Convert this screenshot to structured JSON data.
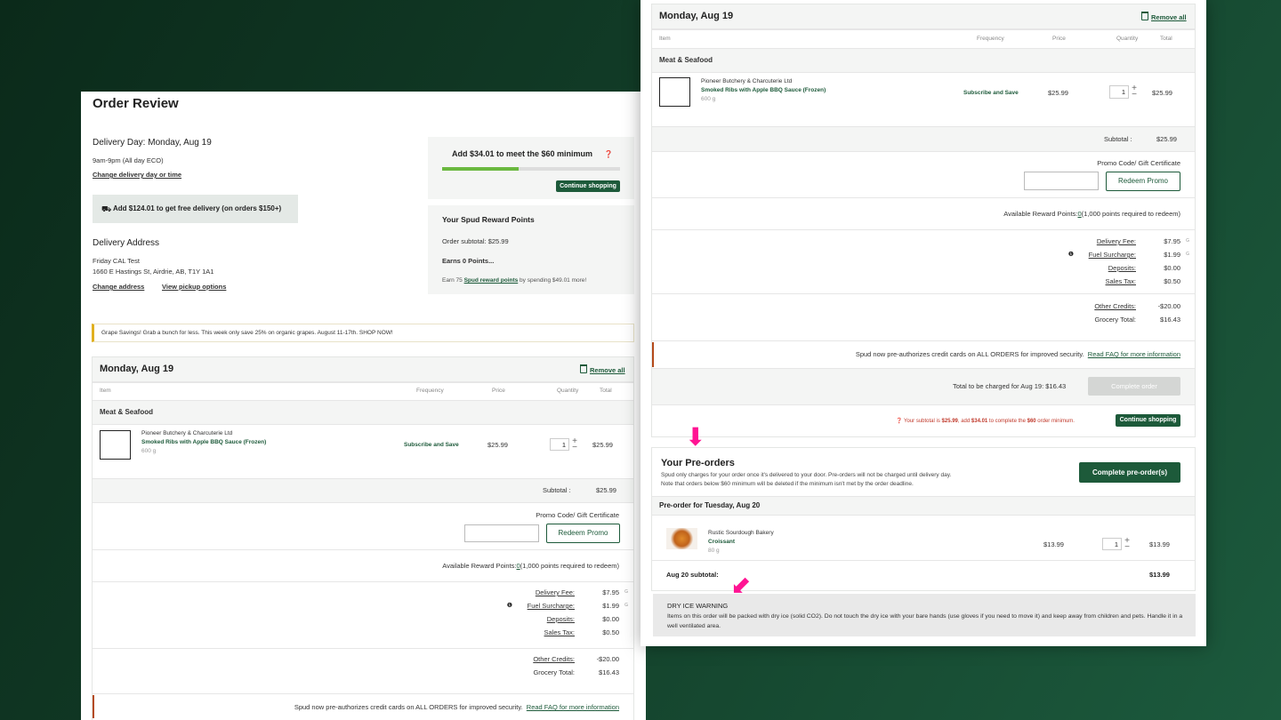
{
  "left": {
    "title": "Order Review",
    "delivery_day": "Delivery Day: Monday, Aug 19",
    "delivery_window": "9am-9pm (All day ECO)",
    "change_day": "Change delivery day or time",
    "free_delivery": "Add $124.01 to get free delivery (on orders $150+)",
    "address_title": "Delivery Address",
    "address_name": "Friday CAL Test",
    "address_line": "1660 E Hastings St, Airdrie, AB, T1Y 1A1",
    "change_address": "Change address",
    "pickup_options": "View pickup options",
    "minimum": {
      "text": "Add $34.01 to meet the $60 minimum",
      "progress": 0.43,
      "button": "Continue shopping"
    },
    "rewards": {
      "title": "Your Spud Reward Points",
      "subtotal": "Order subtotal: $25.99",
      "earns": "Earns 0 Points...",
      "earn_pre": "Earn 75 ",
      "earn_link": "Spud reward points",
      "earn_post": " by spending $49.01 more!"
    },
    "promo_banner": "Grape Savings! Grab a bunch for less. This week only save 25% on organic grapes. August 11-17th. SHOP NOW!",
    "order": {
      "date": "Monday, Aug 19",
      "remove_all": "Remove all",
      "cols": {
        "item": "Item",
        "frequency": "Frequency",
        "price": "Price",
        "quantity": "Quantity",
        "total": "Total"
      },
      "category": "Meat & Seafood",
      "item": {
        "vendor": "Pioneer Butchery & Charcuterie Ltd",
        "name": "Smoked Ribs with Apple BBQ Sauce (Frozen)",
        "size": "600 g",
        "frequency": "Subscribe and Save",
        "price": "$25.99",
        "qty": "1",
        "total": "$25.99"
      },
      "subtotal_label": "Subtotal :",
      "subtotal": "$25.99",
      "promo_label": "Promo Code/ Gift Certificate",
      "redeem": "Redeem Promo",
      "points": "Available Reward Points:",
      "points_link": "0",
      "points_post": "(1,000 points required to redeem)",
      "fees": [
        {
          "label": "Delivery Fee:",
          "value": "$7.95",
          "g": "G",
          "info": false
        },
        {
          "label": "Fuel Surcharge:",
          "value": "$1.99",
          "g": "G",
          "info": true
        },
        {
          "label": "Deposits:",
          "value": "$0.00",
          "g": "",
          "info": false
        },
        {
          "label": "Sales Tax:",
          "value": "$0.50",
          "g": "",
          "info": false
        }
      ],
      "credits_label": "Other Credits:",
      "credits": "-$20.00",
      "grocery_label": "Grocery Total:",
      "grocery": "$16.43",
      "security": "Spud now pre-authorizes credit cards on ALL ORDERS for improved security.",
      "faq": "Read FAQ for more information"
    }
  },
  "right": {
    "order": {
      "date": "Monday, Aug 19",
      "remove_all": "Remove all",
      "cols": {
        "item": "Item",
        "frequency": "Frequency",
        "price": "Price",
        "quantity": "Quantity",
        "total": "Total"
      },
      "category": "Meat & Seafood",
      "item": {
        "vendor": "Pioneer Butchery & Charcuterie Ltd",
        "name": "Smoked Ribs with Apple BBQ Sauce (Frozen)",
        "size": "600 g",
        "frequency": "Subscribe and Save",
        "price": "$25.99",
        "qty": "1",
        "total": "$25.99"
      },
      "subtotal_label": "Subtotal :",
      "subtotal": "$25.99",
      "promo_label": "Promo Code/ Gift Certificate",
      "redeem": "Redeem Promo",
      "points": "Available Reward Points:",
      "points_link": "0",
      "points_post": "(1,000 points required to redeem)",
      "fees": [
        {
          "label": "Delivery Fee:",
          "value": "$7.95",
          "g": "G",
          "info": false
        },
        {
          "label": "Fuel Surcharge:",
          "value": "$1.99",
          "g": "G",
          "info": true
        },
        {
          "label": "Deposits:",
          "value": "$0.00",
          "g": "",
          "info": false
        },
        {
          "label": "Sales Tax:",
          "value": "$0.50",
          "g": "",
          "info": false
        }
      ],
      "credits_label": "Other Credits:",
      "credits": "-$20.00",
      "grocery_label": "Grocery Total:",
      "grocery": "$16.43",
      "security": "Spud now pre-authorizes credit cards on ALL ORDERS for improved security.",
      "faq": "Read FAQ for more information",
      "charged": "Total to be charged for Aug 19: $16.43",
      "complete_order": "Complete order",
      "warn_pre": "Your subtotal is ",
      "warn_sub": "$25.99",
      "warn_mid": ", add ",
      "warn_add": "$34.01",
      "warn_mid2": " to complete the ",
      "warn_min": "$60",
      "warn_post": " order minimum.",
      "continue": "Continue shopping"
    },
    "preorders": {
      "title": "Your Pre-orders",
      "line1": "Spud only charges for your order once it's delivered to your door. Pre-orders will not be charged until delivery day.",
      "line2": "Note that orders below $60 minimum will be deleted if the minimum isn't met by the order deadline.",
      "complete": "Complete pre-order(s)",
      "header": "Pre-order for Tuesday, Aug 20",
      "item": {
        "vendor": "Rustic Sourdough Bakery",
        "name": "Croissant",
        "size": "80 g",
        "price": "$13.99",
        "qty": "1",
        "total": "$13.99"
      },
      "subtotal_label": "Aug 20 subtotal:",
      "subtotal": "$13.99"
    },
    "dry_ice": {
      "title": "DRY ICE WARNING",
      "text": "Items on this order will be packed with dry ice (solid CO2). Do not touch the dry ice with your bare hands (use gloves if you need to move it) and keep away from children and pets. Handle it in a well ventilated area."
    }
  },
  "colors": {
    "brand": "#1d5a3a",
    "accent_arrow": "#ff1493",
    "warning": "#c0392b"
  }
}
